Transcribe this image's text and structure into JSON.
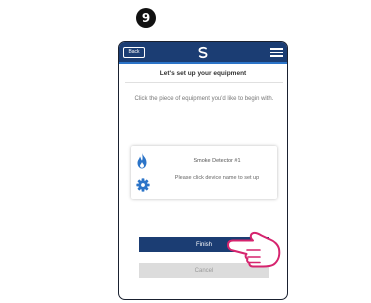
{
  "step_number": "9",
  "header": {
    "back_label": "Back",
    "logo_icon": "salus-logo-icon",
    "menu_icon": "hamburger-menu-icon"
  },
  "screen": {
    "title": "Let's set up your equipment",
    "instruction": "Click the piece of equipment you'd like to begin with."
  },
  "device_card": {
    "type_icon": "flame-icon",
    "settings_icon": "gear-icon",
    "name": "Smoke Detector #1",
    "hint": "Please click device name to set up"
  },
  "buttons": {
    "finish_label": "Finish",
    "cancel_label": "Cancel"
  },
  "overlay": {
    "pointer_icon": "pointing-hand-icon"
  },
  "colors": {
    "header_bg": "#1b3d73",
    "header_accent": "#2b74c8",
    "primary_button": "#1b3d73",
    "disabled_button": "#dcdcdc",
    "icon_blue": "#2b74c8",
    "hand_fill": "#ffffff",
    "hand_outline": "#d6246e"
  }
}
